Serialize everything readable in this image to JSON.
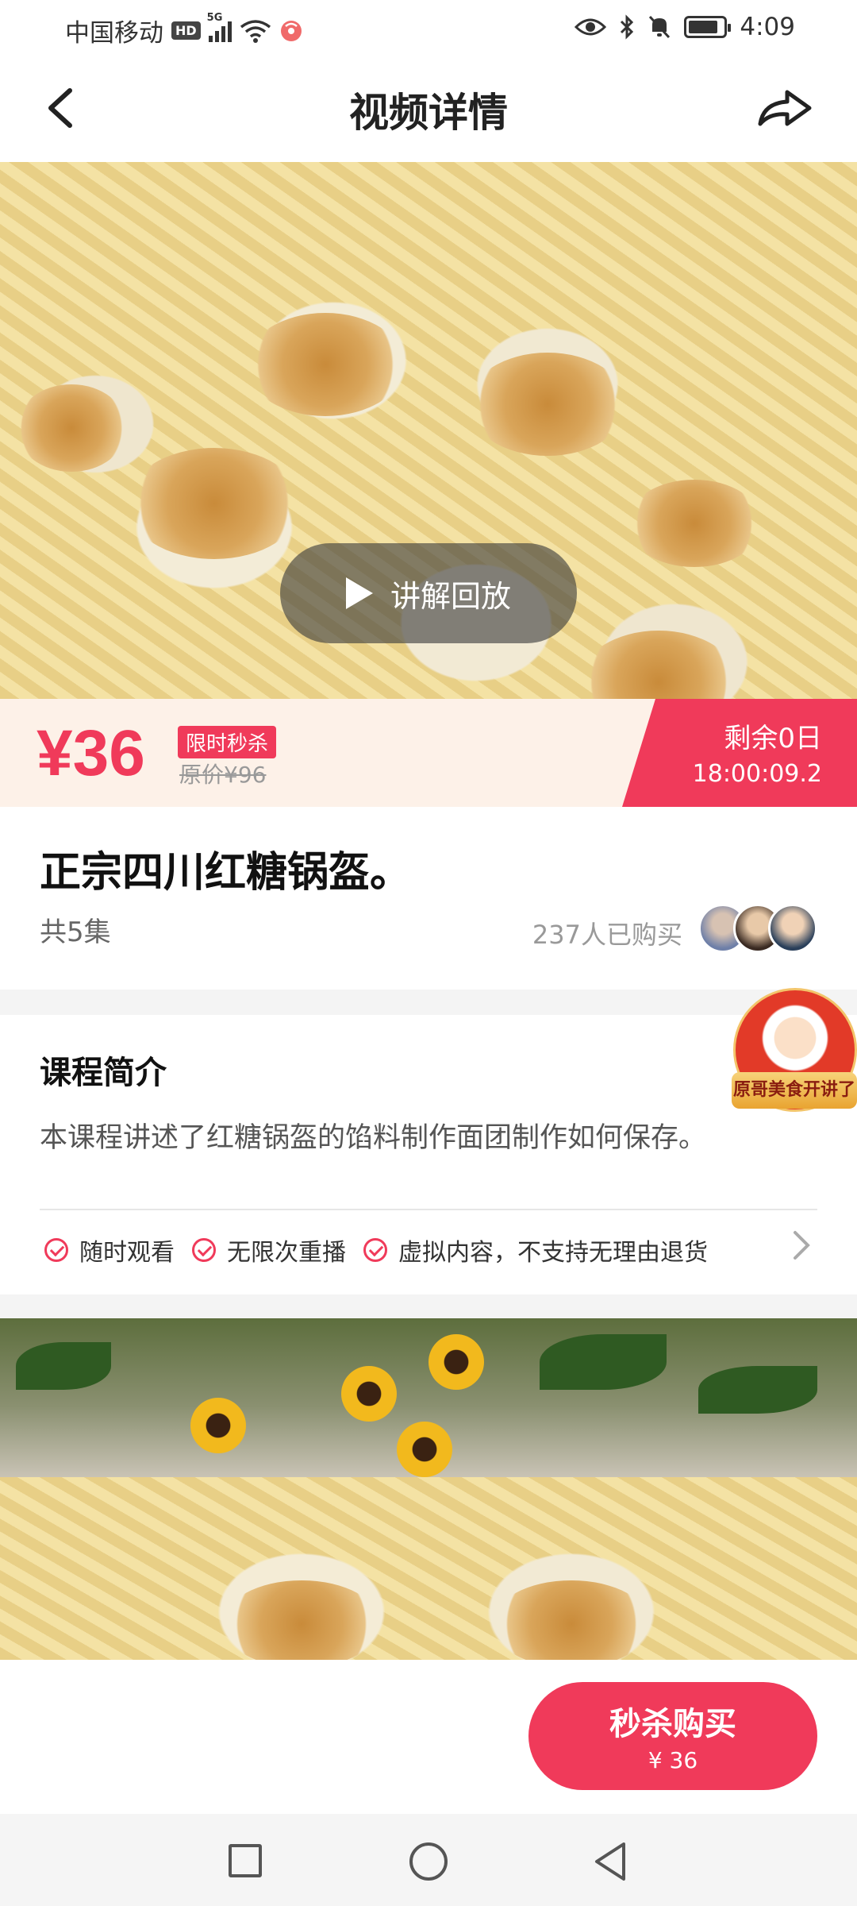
{
  "status_bar": {
    "carrier": "中国移动",
    "hd": "HD",
    "net": "5G",
    "time": "4:09"
  },
  "header": {
    "title": "视频详情",
    "back_icon": "back-arrow-icon",
    "share_icon": "share-icon"
  },
  "hero": {
    "play_label": "讲解回放"
  },
  "price": {
    "current": "¥36",
    "flash_badge": "限时秒杀",
    "original": "原价¥96",
    "countdown_line1": "剩余0日",
    "countdown_line2": "18:00:09.2"
  },
  "course": {
    "title": "正宗四川红糖锅盔。",
    "episodes": "共5集",
    "bought": "237人已购买"
  },
  "intro": {
    "heading": "课程简介",
    "text": "本课程讲述了红糖锅盔的馅料制作面团制作如何保存。",
    "features": [
      {
        "label": "随时观看"
      },
      {
        "label": "无限次重播"
      },
      {
        "label": "虚拟内容，不支持无理由退货"
      }
    ]
  },
  "floating": {
    "chef_banner": "原哥美食开讲了"
  },
  "action": {
    "buy_label": "秒杀购买",
    "buy_price": "¥ 36"
  },
  "colors": {
    "accent": "#f03a5a",
    "price_band_bg": "#fdf1e8"
  }
}
